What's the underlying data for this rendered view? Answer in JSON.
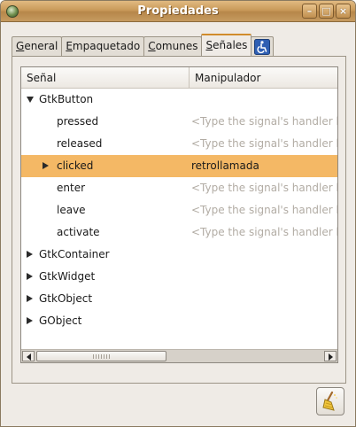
{
  "window": {
    "title": "Propiedades"
  },
  "tabs": [
    {
      "label": "General",
      "mnemonic": "G",
      "rest": "eneral"
    },
    {
      "label": "Empaquetado",
      "mnemonic": "E",
      "rest": "mpaquetado"
    },
    {
      "label": "Comunes",
      "mnemonic": "C",
      "rest": "omunes"
    },
    {
      "label": "Señales",
      "mnemonic": "S",
      "rest": "eñales",
      "active": true
    },
    {
      "label": "accessibility-icon",
      "icon": "accessibility-icon"
    }
  ],
  "columns": {
    "signal": "Señal",
    "handler": "Manipulador"
  },
  "tree": {
    "rows": [
      {
        "name": "GtkButton",
        "level": 0,
        "expander": "expanded",
        "handler": ""
      },
      {
        "name": "pressed",
        "level": 1,
        "expander": "none",
        "handler": "<Type the signal's handler here>",
        "placeholder": true
      },
      {
        "name": "released",
        "level": 1,
        "expander": "none",
        "handler": "<Type the signal's handler here>",
        "placeholder": true
      },
      {
        "name": "clicked",
        "level": 1,
        "expander": "collapsed",
        "handler": "retrollamada",
        "placeholder": false,
        "selected": true
      },
      {
        "name": "enter",
        "level": 1,
        "expander": "none",
        "handler": "<Type the signal's handler here>",
        "placeholder": true
      },
      {
        "name": "leave",
        "level": 1,
        "expander": "none",
        "handler": "<Type the signal's handler here>",
        "placeholder": true
      },
      {
        "name": "activate",
        "level": 1,
        "expander": "none",
        "handler": "<Type the signal's handler here>",
        "placeholder": true
      },
      {
        "name": "GtkContainer",
        "level": 0,
        "expander": "collapsed",
        "handler": ""
      },
      {
        "name": "GtkWidget",
        "level": 0,
        "expander": "collapsed",
        "handler": ""
      },
      {
        "name": "GtkObject",
        "level": 0,
        "expander": "collapsed",
        "handler": ""
      },
      {
        "name": "GObject",
        "level": 0,
        "expander": "collapsed",
        "handler": ""
      }
    ]
  },
  "colors": {
    "selection": "#f4b865",
    "titlebar": "#c99a5a",
    "active_tab_accent": "#d18c2c"
  },
  "icons": {
    "app": "glade-icon",
    "clear": "broom-icon"
  }
}
